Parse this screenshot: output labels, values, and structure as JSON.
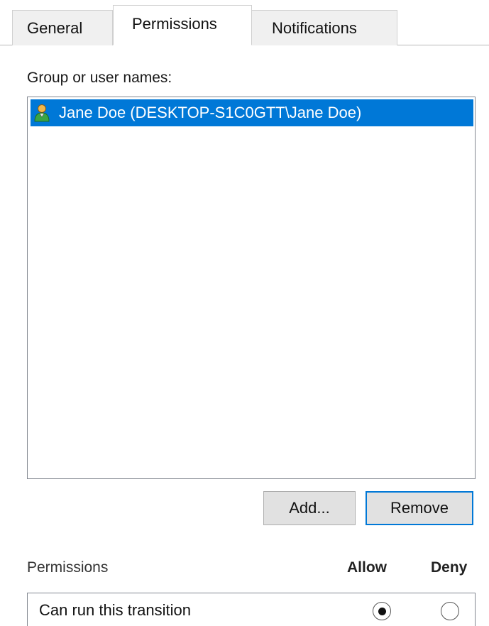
{
  "tabs": [
    {
      "label": "General",
      "active": false
    },
    {
      "label": "Permissions",
      "active": true
    },
    {
      "label": "Notifications",
      "active": false
    }
  ],
  "group_label": "Group or user names:",
  "users": [
    {
      "icon": "user-icon",
      "label": "Jane Doe (DESKTOP-S1C0GTT\\Jane Doe)",
      "selected": true
    }
  ],
  "buttons": {
    "add": "Add...",
    "remove": "Remove"
  },
  "permissions": {
    "title": "Permissions",
    "allow_header": "Allow",
    "deny_header": "Deny",
    "rows": [
      {
        "label": "Can run this transition",
        "allow": true,
        "deny": false
      }
    ]
  },
  "colors": {
    "selection": "#0078d7",
    "focus_border": "#0078d7"
  }
}
